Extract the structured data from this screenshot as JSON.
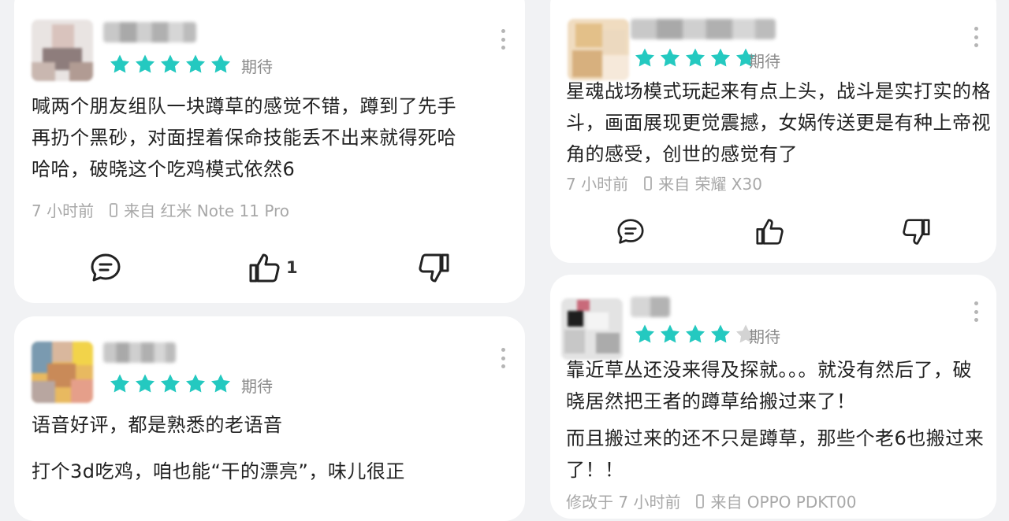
{
  "colors": {
    "star": "#24c9c0",
    "star_empty": "#d3d3d3",
    "icon": "#222222",
    "meta": "#a8a8a8"
  },
  "reviews_left": [
    {
      "rating": 5,
      "tag": "期待",
      "lines": [
        "喊两个朋友组队一块蹲草的感觉不错，蹲到了先手",
        "再扔个黑砂，对面捏着保命技能丢不出来就得死哈",
        "哈哈，破晓这个吃鸡模式依然6"
      ],
      "time": "7 小时前",
      "device": "来自 红米 Note 11 Pro",
      "likes": "1"
    },
    {
      "rating": 5,
      "tag": "期待",
      "para1": "语音好评，都是熟悉的老语音",
      "para2": "打个3d吃鸡，咱也能“干的漂亮”，味儿很正"
    }
  ],
  "reviews_right": [
    {
      "rating": 5,
      "tag": "期待",
      "lines": [
        "星魂战场模式玩起来有点上头，战斗是实打实的格",
        "斗，画面展现更觉震撼，女娲传送更是有种上帝视",
        "角的感受，创世的感觉有了"
      ],
      "time": "7 小时前",
      "device": "来自 荣耀 X30"
    },
    {
      "rating": 4,
      "tag": "期待",
      "lines": [
        "靠近草丛还没来得及探就。。。就没有然后了，破",
        "晓居然把王者的蹲草给搬过来了！"
      ],
      "lines2": [
        "而且搬过来的还不只是蹲草，那些个老6也搬过来",
        "了！！"
      ],
      "time": "修改于 7 小时前",
      "device": "来自 OPPO PDKT00"
    }
  ],
  "icons": [
    "comment-icon",
    "thumbs-up-icon",
    "thumbs-down-icon",
    "more-icon",
    "star-icon",
    "phone-icon"
  ]
}
